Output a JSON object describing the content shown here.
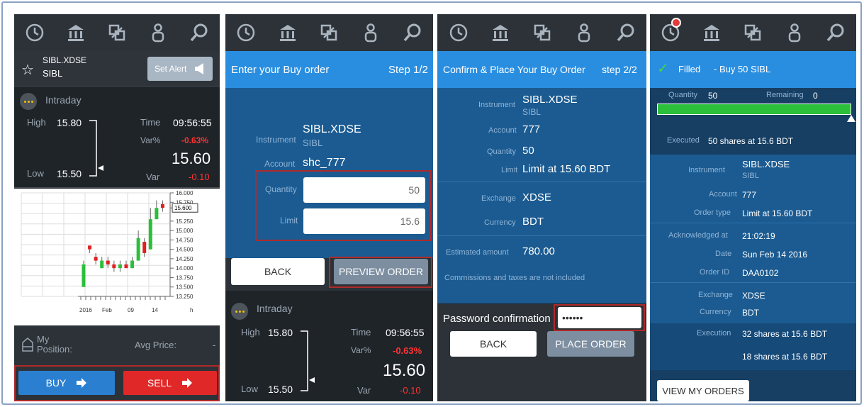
{
  "nav_icons": [
    "clock-icon",
    "bank-icon",
    "trade-icon",
    "user-icon",
    "search-icon"
  ],
  "panel1": {
    "instrument_code": "SIBL.XDSE",
    "instrument_name": "SIBL",
    "set_alert_label": "Set Alert",
    "intraday_label": "Intraday",
    "high_label": "High",
    "high_value": "15.80",
    "low_label": "Low",
    "low_value": "15.50",
    "time_label": "Time",
    "time_value": "09:56:55",
    "varpct_label": "Var%",
    "varpct_value": "-0.63%",
    "price": "15.60",
    "var_label": "Var",
    "var_value": "-0.10",
    "my_position_label_1": "My",
    "my_position_label_2": "Position:",
    "avg_price_label": "Avg Price:",
    "avg_price_value": "-",
    "buy_label": "BUY",
    "sell_label": "SELL"
  },
  "chart_data": {
    "type": "candlestick",
    "y_ticks": [
      "16.000",
      "15.750",
      "15.600",
      "15.250",
      "15.000",
      "14.750",
      "14.500",
      "14.250",
      "14.000",
      "13.750",
      "13.500",
      "13.250"
    ],
    "ylim": [
      13.25,
      16.0
    ],
    "x_ticks": [
      "2016",
      "Feb",
      "09",
      "14",
      "h"
    ],
    "last_price_label": "15.600",
    "candles": [
      {
        "o": 13.5,
        "c": 14.1,
        "h": 14.2,
        "l": 13.5,
        "up": true
      },
      {
        "o": 14.6,
        "c": 14.5,
        "h": 14.6,
        "l": 14.4,
        "up": false
      },
      {
        "o": 14.3,
        "c": 14.2,
        "h": 14.4,
        "l": 14.1,
        "up": false
      },
      {
        "o": 14.0,
        "c": 14.2,
        "h": 14.3,
        "l": 14.0,
        "up": true
      },
      {
        "o": 14.2,
        "c": 14.1,
        "h": 14.3,
        "l": 14.0,
        "up": false
      },
      {
        "o": 14.1,
        "c": 14.0,
        "h": 14.2,
        "l": 13.9,
        "up": false
      },
      {
        "o": 14.0,
        "c": 14.1,
        "h": 14.2,
        "l": 13.9,
        "up": true
      },
      {
        "o": 14.1,
        "c": 14.0,
        "h": 14.2,
        "l": 14.0,
        "up": false
      },
      {
        "o": 14.0,
        "c": 14.2,
        "h": 14.3,
        "l": 14.0,
        "up": true
      },
      {
        "o": 14.2,
        "c": 14.8,
        "h": 15.0,
        "l": 14.2,
        "up": true
      },
      {
        "o": 14.7,
        "c": 14.4,
        "h": 14.8,
        "l": 14.3,
        "up": false
      },
      {
        "o": 14.5,
        "c": 15.3,
        "h": 15.6,
        "l": 14.5,
        "up": true
      },
      {
        "o": 15.3,
        "c": 15.6,
        "h": 15.8,
        "l": 15.3,
        "up": true
      },
      {
        "o": 15.7,
        "c": 15.6,
        "h": 15.8,
        "l": 15.5,
        "up": false
      }
    ]
  },
  "panel2": {
    "header_title": "Enter your Buy order",
    "header_step": "Step 1/2",
    "instrument_label": "Instrument",
    "instrument_code": "SIBL.XDSE",
    "instrument_name": "SIBL",
    "account_label": "Account",
    "account_value": "shc_777",
    "quantity_label": "Quantity",
    "quantity_value": "50",
    "limit_label": "Limit",
    "limit_value": "15.6",
    "back_label": "BACK",
    "preview_label": "PREVIEW ORDER",
    "intraday_label": "Intraday",
    "high_label": "High",
    "high_value": "15.80",
    "low_label": "Low",
    "low_value": "15.50",
    "time_label": "Time",
    "time_value": "09:56:55",
    "varpct_label": "Var%",
    "varpct_value": "-0.63%",
    "price": "15.60",
    "var_label": "Var",
    "var_value": "-0.10"
  },
  "panel3": {
    "header_title": "Confirm & Place Your Buy Order",
    "header_step": "step 2/2",
    "instrument_label": "Instrument",
    "instrument_code": "SIBL.XDSE",
    "instrument_name": "SIBL",
    "account_label": "Account",
    "account_value": "777",
    "quantity_label": "Quantity",
    "quantity_value": "50",
    "limit_label": "Limit",
    "limit_value": "Limit at 15.60 BDT",
    "exchange_label": "Exchange",
    "exchange_value": "XDSE",
    "currency_label": "Currency",
    "currency_value": "BDT",
    "estimated_label": "Estimated amount",
    "estimated_value": "780.00",
    "commission_note": "Commissions and taxes are not included",
    "password_label": "Password confirmation",
    "password_value": "••••••",
    "back_label": "BACK",
    "place_label": "PLACE ORDER"
  },
  "panel4": {
    "status_label": "Filled",
    "status_detail": "- Buy 50 SIBL",
    "quantity_label": "Quantity",
    "quantity_value": "50",
    "remaining_label": "Remaining",
    "remaining_value": "0",
    "fill_fraction": 1.0,
    "executed_label": "Executed",
    "executed_value": "50 shares at 15.6 BDT",
    "instrument_label": "Instrument",
    "instrument_code": "SIBL.XDSE",
    "instrument_name": "SIBL",
    "account_label": "Account",
    "account_value": "777",
    "ordertype_label": "Order type",
    "ordertype_value": "Limit at 15.60 BDT",
    "ack_label": "Acknowledged at",
    "ack_value": "21:02:19",
    "date_label": "Date",
    "date_value": "Sun Feb 14 2016",
    "orderid_label": "Order ID",
    "orderid_value": "DAA0102",
    "exchange_label": "Exchange",
    "exchange_value": "XDSE",
    "currency_label": "Currency",
    "currency_value": "BDT",
    "execution_label": "Execution",
    "execution_1": "32 shares at 15.6 BDT",
    "execution_2": "18 shares at 15.6 BDT",
    "view_orders_label": "VIEW MY ORDERS"
  },
  "colors": {
    "dark_bg": "#1f2429",
    "blue_header": "#2a8ee0",
    "blue_body": "#1b5b91",
    "positive": "#2bbf3a",
    "negative": "#ff3333",
    "highlight_frame": "#b02a2a"
  }
}
